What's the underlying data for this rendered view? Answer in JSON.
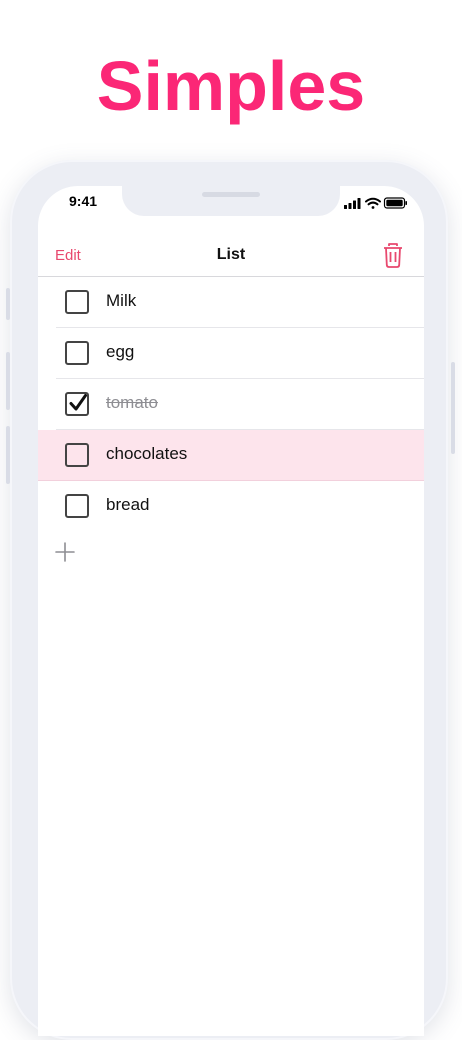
{
  "headline": "Simples",
  "status_bar": {
    "time": "9:41"
  },
  "nav": {
    "edit_label": "Edit",
    "title": "List",
    "trash_icon": "trash-icon"
  },
  "items": [
    {
      "label": "Milk",
      "checked": false,
      "highlighted": false
    },
    {
      "label": "egg",
      "checked": false,
      "highlighted": false
    },
    {
      "label": "tomato",
      "checked": true,
      "highlighted": false
    },
    {
      "label": "chocolates",
      "checked": false,
      "highlighted": true
    },
    {
      "label": "bread",
      "checked": false,
      "highlighted": false
    }
  ],
  "add_icon": "plus-icon",
  "colors": {
    "accent": "#e8486e",
    "headline": "#fb2776",
    "highlight_row": "#fde4ec"
  }
}
